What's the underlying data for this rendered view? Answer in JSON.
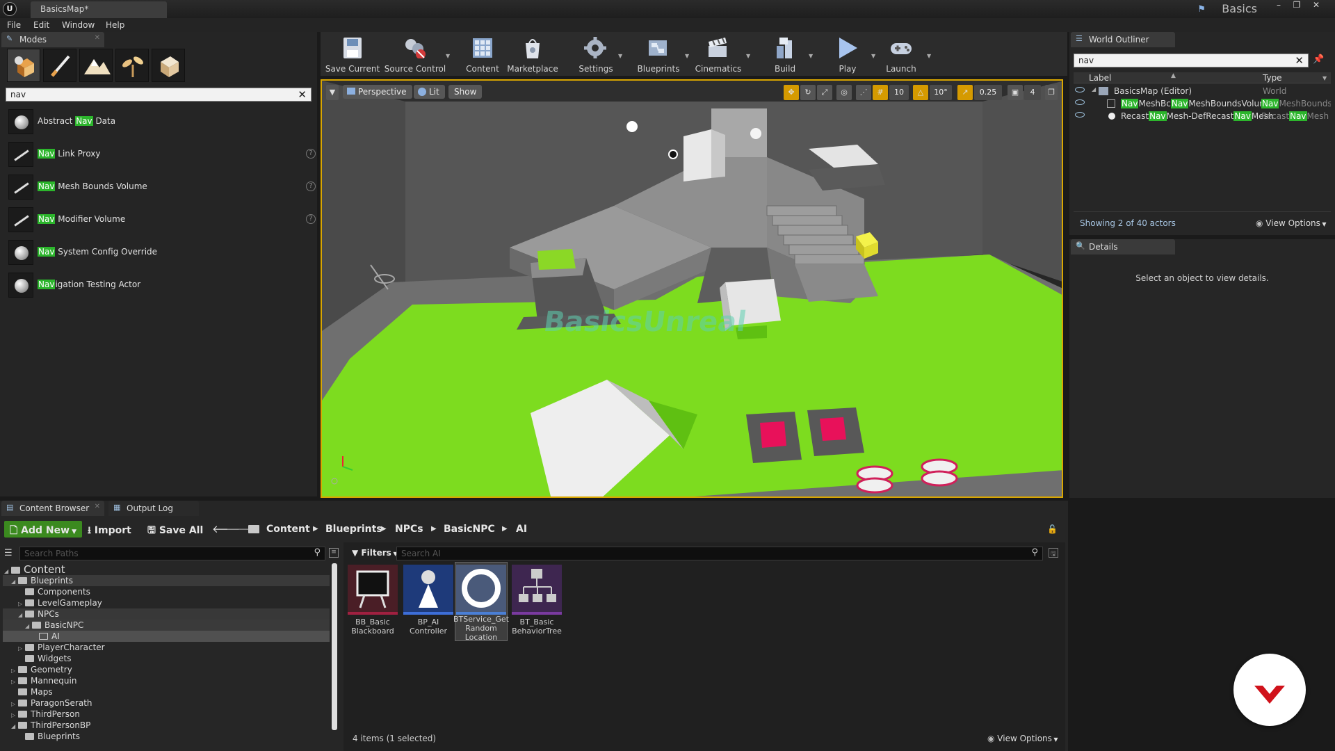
{
  "app": {
    "logo_text": "U",
    "document_tab": "BasicsMap*",
    "project_name": "Basics",
    "project_icon": "flag-icon"
  },
  "menu": [
    "File",
    "Edit",
    "Window",
    "Help"
  ],
  "modes_panel": {
    "tab_label": "Modes",
    "mode_icons": [
      "place-mode-icon",
      "paint-mode-icon",
      "landscape-mode-icon",
      "foliage-mode-icon",
      "geometry-mode-icon"
    ],
    "search_value": "nav",
    "items": [
      {
        "hl": "",
        "rest": "Abstract ",
        "hl2": "Nav",
        "tail": " Data",
        "help": false
      },
      {
        "hl": "Nav",
        "rest": " Link Proxy",
        "hl2": "",
        "tail": "",
        "help": true
      },
      {
        "hl": "Nav",
        "rest": " Mesh Bounds Volume",
        "hl2": "",
        "tail": "",
        "help": true
      },
      {
        "hl": "Nav",
        "rest": " Modifier Volume",
        "hl2": "",
        "tail": "",
        "help": true
      },
      {
        "hl": "Nav",
        "rest": " System Config Override",
        "hl2": "",
        "tail": "",
        "help": false
      },
      {
        "hl": "Nav",
        "rest": "igation Testing Actor",
        "hl2": "",
        "tail": "",
        "help": false
      }
    ]
  },
  "toolbar": {
    "save_current": "Save Current",
    "source_control": "Source Control",
    "content": "Content",
    "marketplace": "Marketplace",
    "settings": "Settings",
    "blueprints": "Blueprints",
    "cinematics": "Cinematics",
    "build": "Build",
    "play": "Play",
    "launch": "Launch"
  },
  "viewport": {
    "view_mode": "Perspective",
    "lighting": "Lit",
    "show": "Show",
    "grid_snap": "10",
    "rotation_snap": "10°",
    "scale_snap": "0.25",
    "camera_speed": "4",
    "floor_text": "BasicsUnreal",
    "floor_colors": {
      "nav_green": "#7ddc1f",
      "walls": "#8a8a8a"
    }
  },
  "world_outliner": {
    "tab_label": "World Outliner",
    "search_value": "nav",
    "col_label": "Label",
    "col_type": "Type",
    "rows": [
      {
        "label": "BasicsMap (Editor)",
        "type": "World"
      },
      {
        "label_parts": [
          "Nav",
          "MeshBc",
          "Nav",
          "MeshBoundsVolume"
        ],
        "type_parts": [
          "Nav",
          "MeshBoundsV"
        ]
      },
      {
        "label_parts": [
          "Recast",
          "Nav",
          "Mesh-DefRecast",
          "Nav",
          "Mesh"
        ],
        "type_parts": [
          "Recast",
          "Nav",
          "Mesh"
        ]
      }
    ],
    "status": "Showing 2 of 40 actors",
    "view_options": "View Options"
  },
  "details": {
    "tab_label": "Details",
    "empty_text": "Select an object to view details."
  },
  "content_browser": {
    "tab_label": "Content Browser",
    "output_log_label": "Output Log",
    "add_new": "Add New",
    "import": "Import",
    "save_all": "Save All",
    "breadcrumbs": [
      "Content",
      "Blueprints",
      "NPCs",
      "BasicNPC",
      "AI"
    ],
    "search_paths_placeholder": "Search Paths",
    "filters": "Filters",
    "search_assets_placeholder": "Search AI",
    "tree": [
      {
        "label": "Content",
        "depth": 0,
        "arrow": "open"
      },
      {
        "label": "Blueprints",
        "depth": 1,
        "arrow": "open"
      },
      {
        "label": "Components",
        "depth": 2,
        "arrow": ""
      },
      {
        "label": "LevelGameplay",
        "depth": 2,
        "arrow": "closed"
      },
      {
        "label": "NPCs",
        "depth": 2,
        "arrow": "open"
      },
      {
        "label": "BasicNPC",
        "depth": 3,
        "arrow": "open"
      },
      {
        "label": "AI",
        "depth": 4,
        "arrow": ""
      },
      {
        "label": "PlayerCharacter",
        "depth": 2,
        "arrow": "closed"
      },
      {
        "label": "Widgets",
        "depth": 2,
        "arrow": ""
      },
      {
        "label": "Geometry",
        "depth": 1,
        "arrow": "closed"
      },
      {
        "label": "Mannequin",
        "depth": 1,
        "arrow": "closed"
      },
      {
        "label": "Maps",
        "depth": 1,
        "arrow": ""
      },
      {
        "label": "ParagonSerath",
        "depth": 1,
        "arrow": "closed"
      },
      {
        "label": "ThirdPerson",
        "depth": 1,
        "arrow": "closed"
      },
      {
        "label": "ThirdPersonBP",
        "depth": 1,
        "arrow": "open"
      },
      {
        "label": "Blueprints",
        "depth": 2,
        "arrow": ""
      }
    ],
    "assets": [
      {
        "label": "BB_Basic Blackboard",
        "color": "#7a1e2e"
      },
      {
        "label": "BP_AI Controller",
        "color": "#3d6ed8"
      },
      {
        "label": "BTService_Get Random Location",
        "color": "#4a7fd6"
      },
      {
        "label": "BT_Basic BehaviorTree",
        "color": "#7a3aa0"
      }
    ],
    "status": "4 items (1 selected)",
    "view_options": "View Options"
  },
  "overlay_logo_color": "#d0121b"
}
